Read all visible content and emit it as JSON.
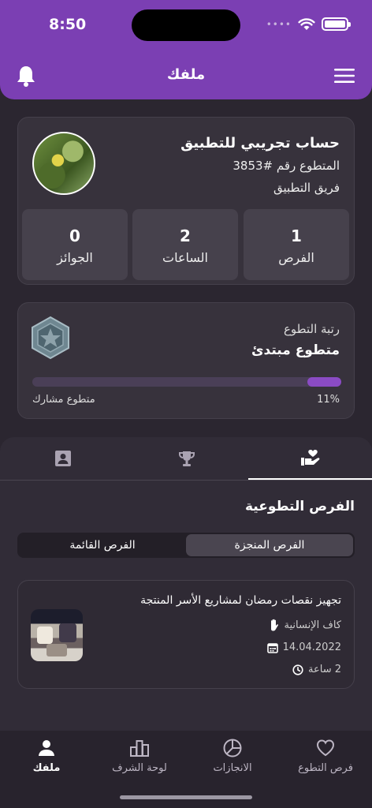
{
  "status_bar": {
    "time": "8:50",
    "dots": "••••"
  },
  "header": {
    "title": "ملفك",
    "bell_icon": "bell-icon",
    "menu_icon": "hamburger-icon"
  },
  "profile": {
    "name": "حساب تجريبي للتطبيق",
    "volunteer_number": "المتطوع رقم #3853",
    "team": "فريق التطبيق",
    "stats": [
      {
        "value": "1",
        "label": "الفرص"
      },
      {
        "value": "2",
        "label": "الساعات"
      },
      {
        "value": "0",
        "label": "الجوائز"
      }
    ]
  },
  "rank": {
    "label": "رتبة التطوع",
    "value": "متطوع مبتدئ",
    "progress_percent": 11,
    "progress_text": "11%",
    "next_rank": "متطوع مشارك"
  },
  "tabs": [
    {
      "icon": "volunteer-hand-heart-icon",
      "active": true
    },
    {
      "icon": "trophy-icon",
      "active": false
    },
    {
      "icon": "contact-card-icon",
      "active": false
    }
  ],
  "opportunities": {
    "title": "الفرص التطوعية",
    "segments": [
      {
        "label": "الفرص المنجزة",
        "active": true
      },
      {
        "label": "الفرص القائمة",
        "active": false
      }
    ],
    "items": [
      {
        "title": "تجهيز نقصات رمضان لمشاريع الأسر المنتجة",
        "organization": "كاف الإنسانية",
        "date": "14.04.2022",
        "hours": "2 ساعة"
      }
    ]
  },
  "bottom_nav": [
    {
      "label": "فرص التطوع",
      "icon": "heart-icon"
    },
    {
      "label": "الانجازات",
      "icon": "pie-chart-icon"
    },
    {
      "label": "لوحة الشرف",
      "icon": "leaderboard-icon"
    },
    {
      "label": "ملفك",
      "icon": "person-icon",
      "active": true
    }
  ],
  "colors": {
    "header": "#7b3fb3",
    "background": "#2b2630",
    "card": "#37323c",
    "progress": "#8a4bc4"
  }
}
